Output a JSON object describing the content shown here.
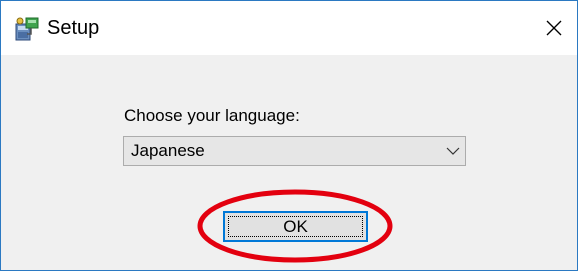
{
  "window": {
    "title": "Setup",
    "close_symbol": "✕"
  },
  "dialog": {
    "prompt": "Choose your language:",
    "language_select": {
      "selected": "Japanese"
    },
    "ok_label": "OK"
  },
  "annotation": {
    "highlight_color": "#e3000f"
  },
  "icons": {
    "app": "setup-installer-icon",
    "dropdown": "chevron-down-icon",
    "close": "close-icon"
  }
}
